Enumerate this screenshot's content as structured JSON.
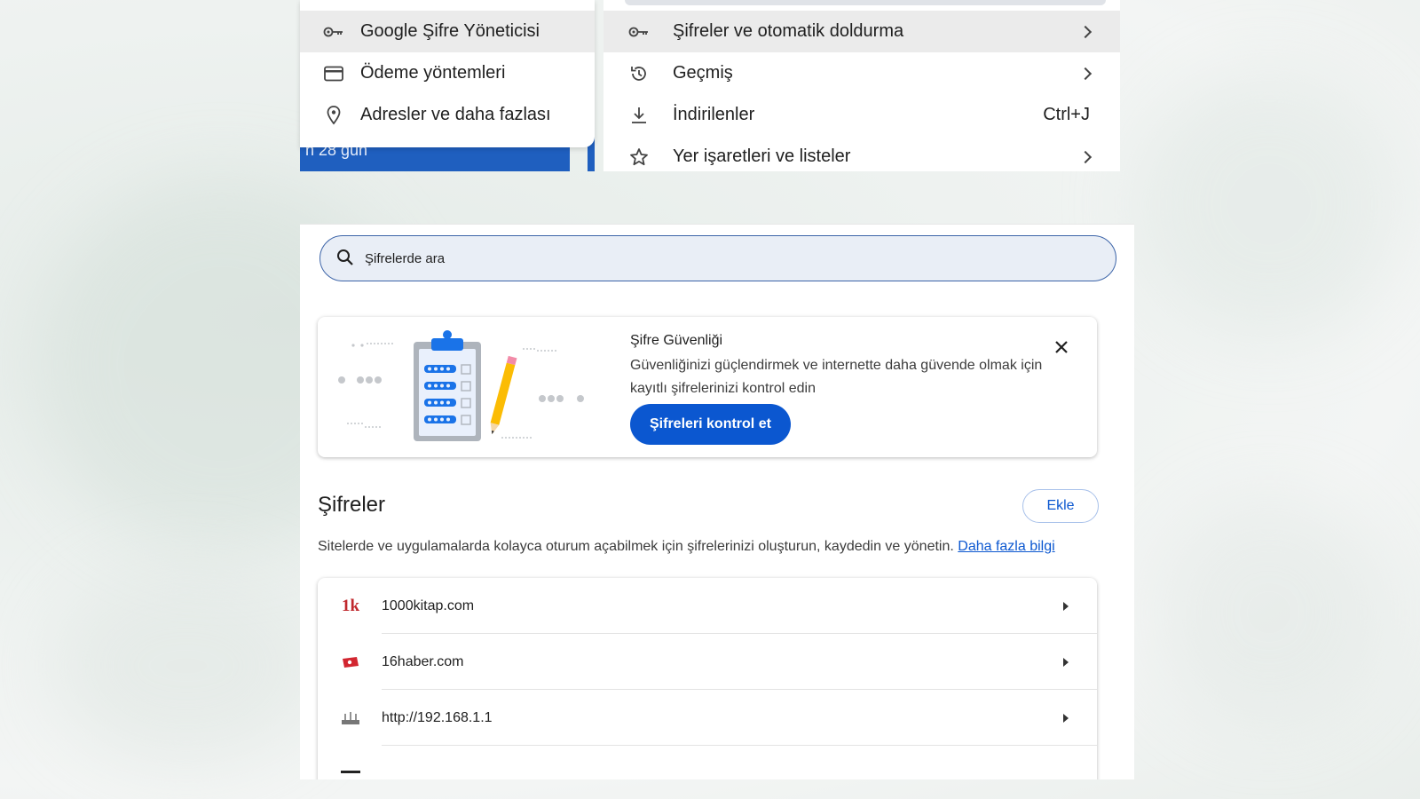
{
  "submenu": {
    "items": [
      {
        "label": "Google Şifre Yöneticisi",
        "icon": "key-icon",
        "highlighted": true
      },
      {
        "label": "Ödeme yöntemleri",
        "icon": "credit-card-icon",
        "highlighted": false
      },
      {
        "label": "Adresler ve daha fazlası",
        "icon": "location-pin-icon",
        "highlighted": false
      }
    ],
    "background_strip_text": "n 28 gün"
  },
  "main_menu": {
    "items": [
      {
        "label": "Şifreler ve otomatik doldurma",
        "icon": "key-icon",
        "right": "chevron-right-icon",
        "highlighted": true
      },
      {
        "label": "Geçmiş",
        "icon": "history-icon",
        "right": "chevron-right-icon",
        "highlighted": false
      },
      {
        "label": "İndirilenler",
        "icon": "download-icon",
        "shortcut": "Ctrl+J",
        "highlighted": false
      },
      {
        "label": "Yer işaretleri ve listeler",
        "icon": "star-icon",
        "right": "chevron-right-icon",
        "highlighted": false
      }
    ]
  },
  "search": {
    "placeholder": "Şifrelerde ara"
  },
  "security_card": {
    "title": "Şifre Güvenliği",
    "description": "Güvenliğinizi güçlendirmek ve internette daha güvende olmak için kayıtlı şifrelerinizi kontrol edin",
    "button_label": "Şifreleri kontrol et"
  },
  "passwords_section": {
    "title": "Şifreler",
    "add_label": "Ekle",
    "description": "Sitelerde ve uygulamalarda kolayca oturum açabilmek için şifrelerinizi oluşturun, kaydedin ve yönetin.",
    "learn_more": "Daha fazla bilgi"
  },
  "password_list": [
    {
      "site": "1000kitap.com",
      "favicon_text": "1k",
      "favicon_color": "#c0282d"
    },
    {
      "site": "16haber.com",
      "favicon_text": "",
      "favicon_color": "#d22630"
    },
    {
      "site": "http://192.168.1.1",
      "favicon_text": "",
      "favicon_color": "#555555"
    }
  ],
  "colors": {
    "accent": "#0b57d0",
    "blue_strip": "#1f5fbf"
  }
}
